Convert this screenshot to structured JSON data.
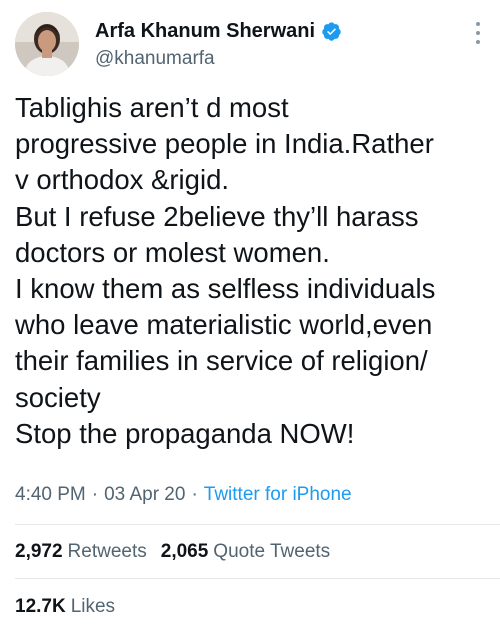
{
  "author": {
    "display_name": "Arfa Khanum Sherwani",
    "handle": "@khanumarfa",
    "verified": true
  },
  "tweet": {
    "lines": [
      "Tablighis aren’t d most",
      "progressive people in India.Rather",
      "v orthodox &rigid.",
      "But I refuse 2believe thy’ll harass",
      "doctors or molest women.",
      "I know them as selfless individuals",
      "who leave materialistic world,even",
      "their families in service of religion/",
      "society",
      "Stop the propaganda NOW!"
    ],
    "time": "4:40 PM",
    "separator": "·",
    "date": "03 Apr 20",
    "source": "Twitter for iPhone"
  },
  "stats": {
    "retweets_count": "2,972",
    "retweets_label": "Retweets",
    "quotes_count": "2,065",
    "quotes_label": "Quote Tweets",
    "likes_count": "12.7K",
    "likes_label": "Likes"
  },
  "colors": {
    "accent": "#1d9bf0",
    "secondary_text": "#536471",
    "primary_text": "#0f1419"
  },
  "icons": {
    "verified": "verified-badge-icon",
    "more": "more-options-icon"
  }
}
